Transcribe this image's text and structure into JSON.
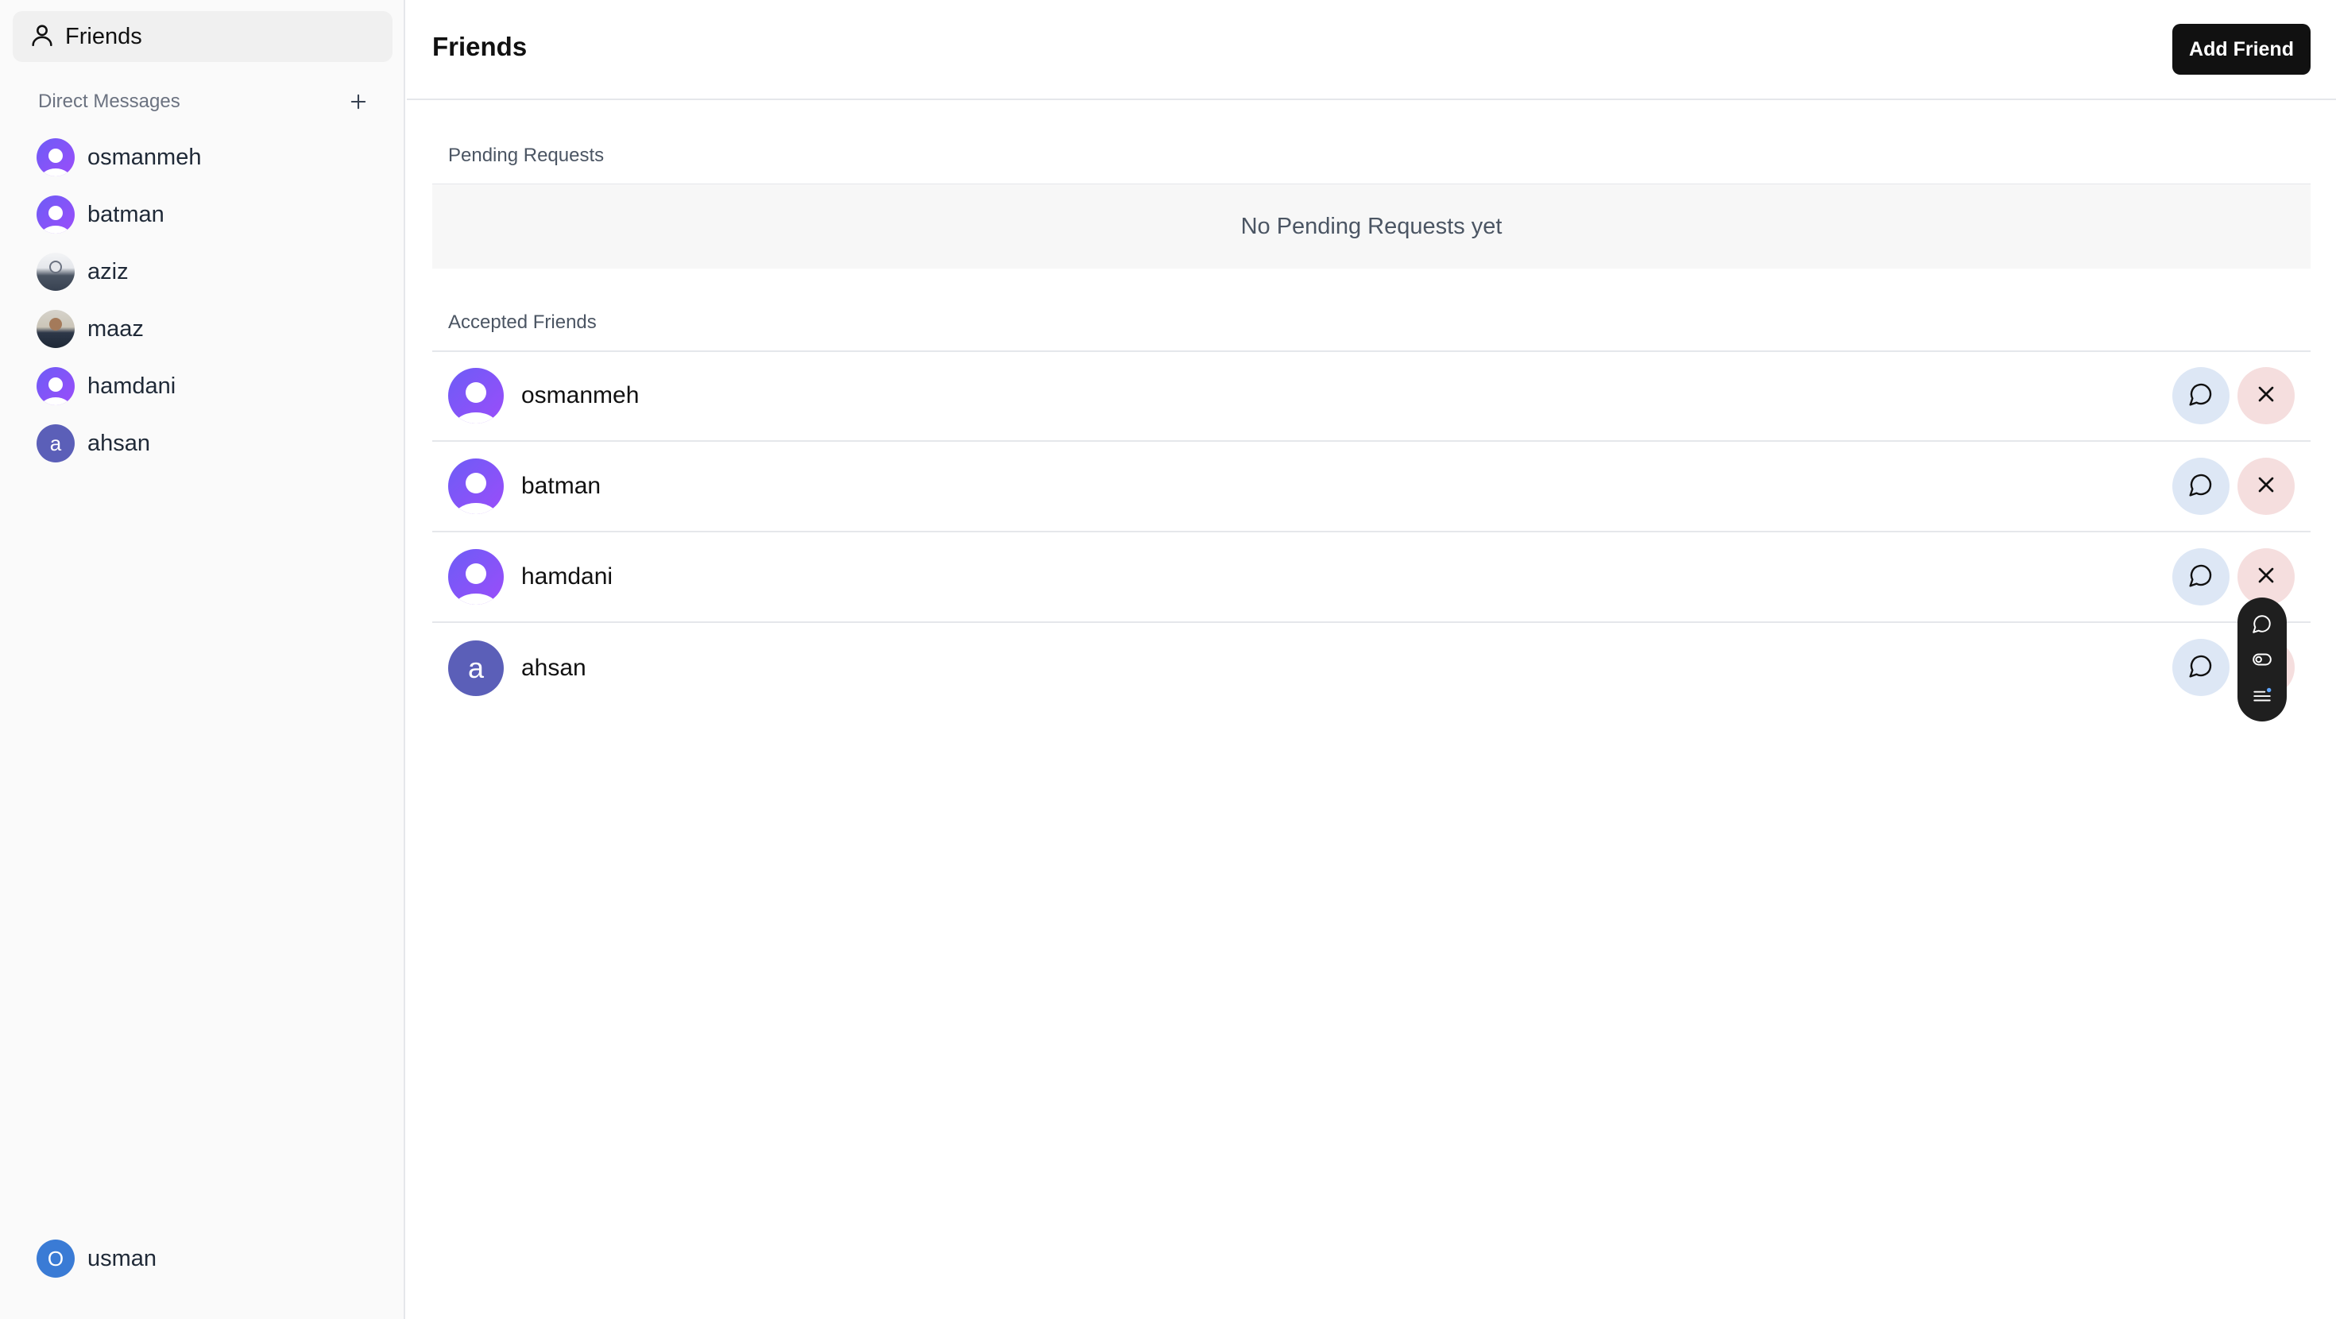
{
  "sidebar": {
    "nav_friends_label": "Friends",
    "dm_header_label": "Direct Messages",
    "dm_items": [
      {
        "name": "osmanmeh",
        "avatar": "default"
      },
      {
        "name": "batman",
        "avatar": "default"
      },
      {
        "name": "aziz",
        "avatar": "photo"
      },
      {
        "name": "maaz",
        "avatar": "photo"
      },
      {
        "name": "hamdani",
        "avatar": "default"
      },
      {
        "name": "ahsan",
        "avatar": "letter",
        "initial": "a"
      }
    ],
    "current_user": {
      "name": "usman",
      "initial": "O"
    }
  },
  "main": {
    "title": "Friends",
    "add_friend_label": "Add Friend",
    "pending_label": "Pending Requests",
    "pending_empty": "No Pending Requests yet",
    "accepted_label": "Accepted Friends",
    "friends": [
      {
        "name": "osmanmeh",
        "avatar": "default"
      },
      {
        "name": "batman",
        "avatar": "default"
      },
      {
        "name": "hamdani",
        "avatar": "default"
      },
      {
        "name": "ahsan",
        "avatar": "letter",
        "initial": "a"
      }
    ]
  },
  "icons": {
    "nav_friends": "user-icon",
    "add_dm": "plus-icon",
    "message": "message-circle-icon",
    "remove": "x-icon",
    "float_toolbar": [
      "chat-icon",
      "toggle-icon",
      "list-icon"
    ]
  },
  "colors": {
    "accent_dark": "#111111",
    "avatar_gradient_start": "#6d5cf6",
    "avatar_gradient_end": "#9b4dfa",
    "letter_avatar": "#5b5fb8",
    "current_user_avatar": "#3a7bd5",
    "message_button_bg": "#dde7f5",
    "remove_button_bg": "#f5dede"
  }
}
